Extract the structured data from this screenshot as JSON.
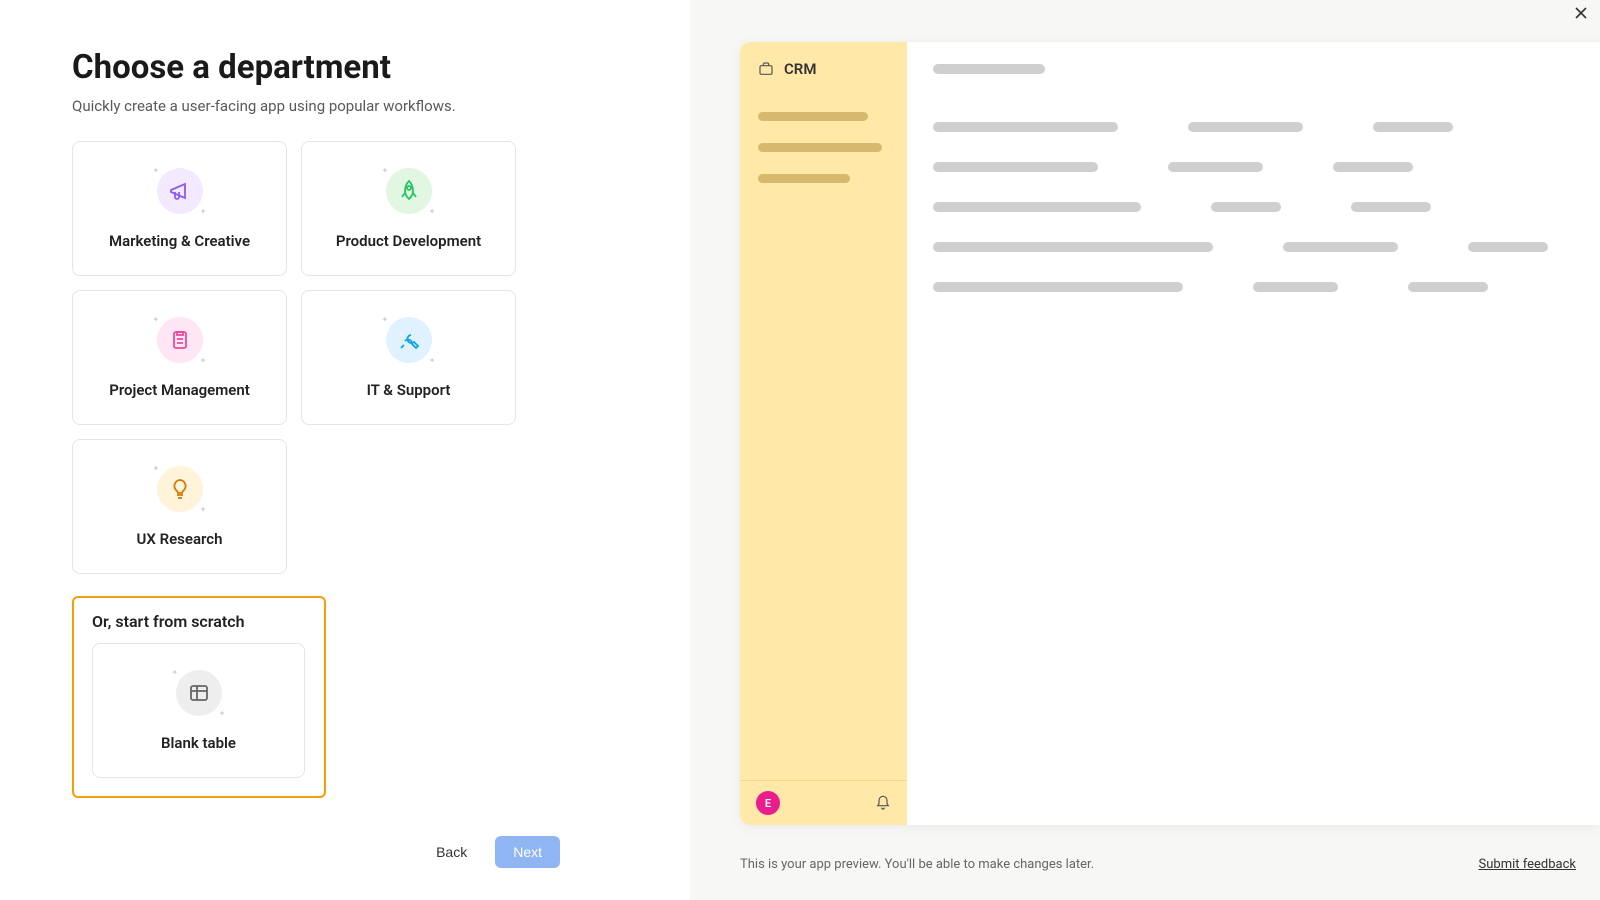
{
  "header": {
    "title": "Choose a department",
    "subtitle": "Quickly create a user-facing app using popular workflows."
  },
  "departments": [
    {
      "label": "Marketing & Creative",
      "icon": "megaphone",
      "color": "purple"
    },
    {
      "label": "Product Development",
      "icon": "rocket",
      "color": "green"
    },
    {
      "label": "Project Management",
      "icon": "clipboard",
      "color": "pink"
    },
    {
      "label": "IT & Support",
      "icon": "wrench",
      "color": "blue"
    },
    {
      "label": "UX Research",
      "icon": "lightbulb",
      "color": "yellow"
    }
  ],
  "scratch": {
    "heading": "Or, start from scratch",
    "card_label": "Blank table"
  },
  "buttons": {
    "back": "Back",
    "next": "Next"
  },
  "preview": {
    "sidebar_title": "CRM",
    "avatar_letter": "E",
    "footer_text": "This is your app preview. You'll be able to make changes later.",
    "feedback_link": "Submit feedback"
  },
  "colors": {
    "accent_orange": "#f59e0b",
    "next_button": "#8fb6f3",
    "avatar": "#e91e8c",
    "sidebar_bg": "#ffe8a8"
  }
}
